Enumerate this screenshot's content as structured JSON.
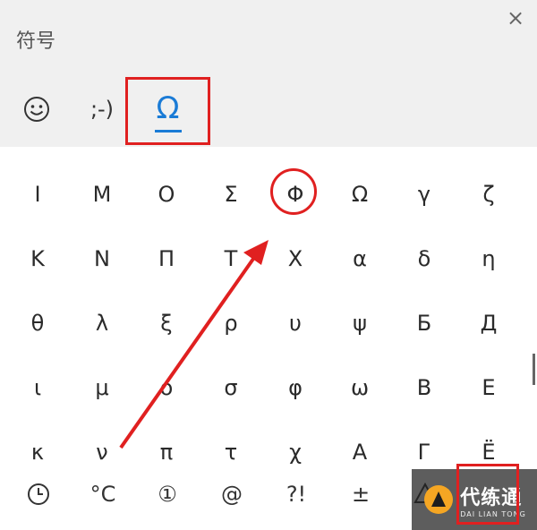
{
  "title": "符号",
  "close_label": "×",
  "tabs": [
    {
      "name": "emoji",
      "icon": "smiley-icon"
    },
    {
      "name": "kaomoji",
      "label": ";-)"
    },
    {
      "name": "symbols",
      "label": "Ω",
      "selected": true
    }
  ],
  "symbols": [
    [
      "Ι",
      "Μ",
      "Ο",
      "Σ",
      "Φ",
      "Ω",
      "γ",
      "ζ"
    ],
    [
      "Κ",
      "Ν",
      "Π",
      "Τ",
      "Χ",
      "α",
      "δ",
      "η"
    ],
    [
      "θ",
      "λ",
      "ξ",
      "ρ",
      "υ",
      "ψ",
      "Б",
      "Д"
    ],
    [
      "ι",
      "μ",
      "ο",
      "σ",
      "φ",
      "ω",
      "В",
      "Е"
    ],
    [
      "κ",
      "ν",
      "π",
      "τ",
      "χ",
      "А",
      "Г",
      "Ё"
    ]
  ],
  "bottom_categories": [
    {
      "label": "",
      "icon": "clock-icon"
    },
    {
      "label": "°C"
    },
    {
      "label": "①"
    },
    {
      "label": "@"
    },
    {
      "label": "?!"
    },
    {
      "label": "±"
    },
    {
      "label": "",
      "icon": "triangle-icon"
    },
    {
      "label": ""
    }
  ],
  "watermark": {
    "main": "代练通",
    "sub": "DAI LIAN TONG"
  },
  "colors": {
    "accent": "#1a7bd6",
    "annotation": "#e02020",
    "header_bg": "#f0f0f0"
  }
}
